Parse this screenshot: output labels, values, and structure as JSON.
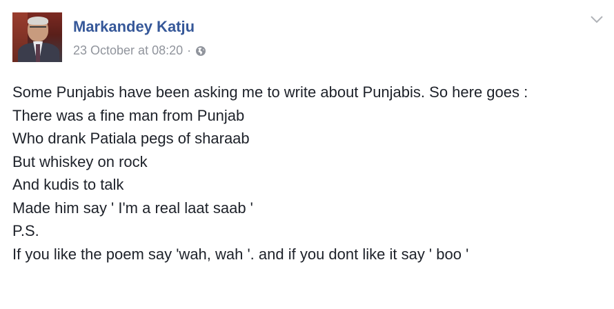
{
  "post": {
    "author": "Markandey Katju",
    "timestamp": "23 October at 08:20",
    "separator": "·",
    "privacy_icon": "globe-icon",
    "options_icon": "chevron-down-icon",
    "name_color": "#365899",
    "text_color": "#1d2129",
    "meta_color": "#90949c",
    "lines": [
      "Some Punjabis have been asking me to write about Punjabis. So here goes :",
      "There was a fine man from Punjab",
      "Who drank Patiala pegs of sharaab",
      "But whiskey on rock",
      "And kudis to talk",
      "Made him say ' I'm a real laat saab '",
      "P.S.",
      "If you like the poem say 'wah, wah '. and if you dont like it say ' boo '"
    ]
  }
}
